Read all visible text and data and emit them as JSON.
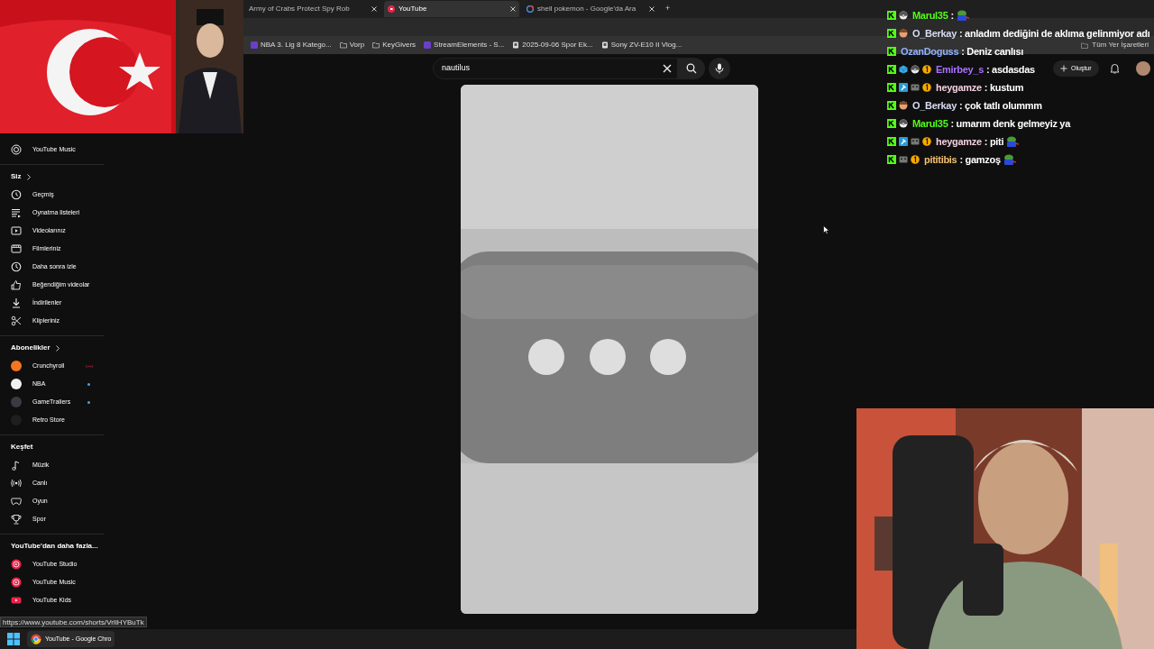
{
  "tabs": [
    {
      "title": "Army of Crabs Protect Spy Rob",
      "kind": "plain",
      "selected": false
    },
    {
      "title": "YouTube",
      "kind": "youtube",
      "selected": true
    },
    {
      "title": "shell pokemon - Google'da Ara",
      "kind": "google",
      "selected": false
    }
  ],
  "new_tab": "+",
  "bookmarks": [
    {
      "label": "NBA 3. Lig 8 Katego...",
      "kind": "app"
    },
    {
      "label": "Vorp",
      "kind": "folder"
    },
    {
      "label": "KeyGivers",
      "kind": "folder"
    },
    {
      "label": "StreamElements - S...",
      "kind": "app"
    },
    {
      "label": "2025-09-06 Spor Ek...",
      "kind": "page"
    },
    {
      "label": "Sony ZV-E10 II Vlog...",
      "kind": "page"
    }
  ],
  "all_bookmarks": "Tüm Yer İşaretleri",
  "search": {
    "value": "nautilus"
  },
  "create_button": "Oluştur",
  "sidebar": [
    {
      "kind": "plain",
      "items": [
        {
          "label": "YouTube Music",
          "kind": "music"
        }
      ]
    },
    {
      "kind": "link",
      "heading": "Siz",
      "items": [
        {
          "label": "Geçmiş",
          "kind": "history"
        },
        {
          "label": "Oynatma listeleri",
          "kind": "playlist"
        },
        {
          "label": "Videolarınız",
          "kind": "video"
        },
        {
          "label": "Filmleriniz",
          "kind": "film"
        },
        {
          "label": "Daha sonra izle",
          "kind": "clock"
        },
        {
          "label": "Beğendiğim videolar",
          "kind": "like"
        },
        {
          "label": "İndirilenler",
          "kind": "download"
        },
        {
          "label": "Klipleriniz",
          "kind": "scissors"
        }
      ]
    },
    {
      "kind": "link",
      "heading": "Abonelikler",
      "items": [
        {
          "label": "Crunchyroll",
          "kind": "channel",
          "color": "#f47521",
          "live": true,
          "new_videos": false
        },
        {
          "label": "NBA",
          "kind": "channel",
          "color": "#f1f1f1",
          "live": false,
          "new_videos": true
        },
        {
          "label": "GameTrailers",
          "kind": "channel",
          "color": "#3a3a44",
          "live": false,
          "new_videos": true
        },
        {
          "label": "Retro Store",
          "kind": "channel",
          "color": "#1f1f22",
          "live": false,
          "new_videos": false
        }
      ]
    },
    {
      "kind": "heading",
      "heading": "Keşfet",
      "items": [
        {
          "label": "Müzik",
          "kind": "note"
        },
        {
          "label": "Canlı",
          "kind": "live"
        },
        {
          "label": "Oyun",
          "kind": "game"
        },
        {
          "label": "Spor",
          "kind": "trophy"
        }
      ]
    },
    {
      "kind": "heading",
      "heading": "YouTube'dan daha fazla...",
      "items": [
        {
          "label": "YouTube Studio",
          "kind": "ytapp"
        },
        {
          "label": "YouTube Music",
          "kind": "ytapp"
        },
        {
          "label": "YouTube Kids",
          "kind": "ytkids"
        }
      ]
    }
  ],
  "status_url": "https://www.youtube.com/shorts/VrIlHYBuTk",
  "taskbar": {
    "app": "YouTube - Google Chro"
  },
  "chat": [
    {
      "badges": [
        {
          "kind": "kick"
        },
        {
          "kind": "pokeball"
        }
      ],
      "user": "Marul35",
      "color": "#53fc18",
      "text": ":",
      "emote": true
    },
    {
      "badges": [
        {
          "kind": "kick"
        },
        {
          "kind": "avatar"
        }
      ],
      "user": "O_Berkay",
      "color": "#d8dcf0",
      "text": ": anladım dediğini de aklıma gelinmiyor adı",
      "emote": false
    },
    {
      "badges": [
        {
          "kind": "kick"
        }
      ],
      "user": "OzanDoguss",
      "color": "#8fb1ff",
      "text": ": Deniz canlısı",
      "emote": false
    },
    {
      "badges": [
        {
          "kind": "kick"
        },
        {
          "kind": "cube"
        },
        {
          "kind": "pokeball"
        },
        {
          "kind": "coin"
        }
      ],
      "user": "Emirbey_s",
      "color": "#a970ff",
      "text": ": asdasdas",
      "emote": false
    },
    {
      "badges": [
        {
          "kind": "kick"
        },
        {
          "kind": "hammer"
        },
        {
          "kind": "robot"
        },
        {
          "kind": "coin"
        }
      ],
      "user": "heygamze",
      "color": "#f3d0e0",
      "text": ": kustum",
      "emote": false
    },
    {
      "badges": [
        {
          "kind": "kick"
        },
        {
          "kind": "avatar"
        }
      ],
      "user": "O_Berkay",
      "color": "#d8dcf0",
      "text": ": çok tatlı olummm",
      "emote": false
    },
    {
      "badges": [
        {
          "kind": "kick"
        },
        {
          "kind": "pokeball"
        }
      ],
      "user": "Marul35",
      "color": "#53fc18",
      "text": ": umarım denk gelmeyiz ya",
      "emote": false
    },
    {
      "badges": [
        {
          "kind": "kick"
        },
        {
          "kind": "hammer"
        },
        {
          "kind": "robot"
        },
        {
          "kind": "coin"
        }
      ],
      "user": "heygamze",
      "color": "#f3d0e0",
      "text": ": piti",
      "emote": true
    },
    {
      "badges": [
        {
          "kind": "kick"
        },
        {
          "kind": "robot"
        },
        {
          "kind": "coin"
        }
      ],
      "user": "pititibis",
      "color": "#f5c070",
      "text": ": gamzoş",
      "emote": true
    }
  ]
}
